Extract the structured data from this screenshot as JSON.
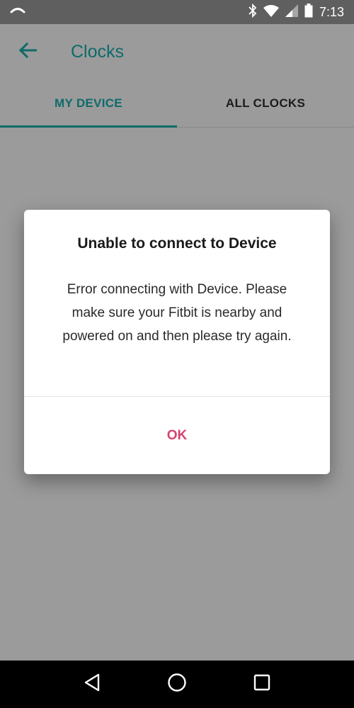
{
  "status_bar": {
    "time": "7:13",
    "icons": [
      "hotspot-icon",
      "bluetooth-icon",
      "wifi-icon",
      "signal-icon",
      "battery-icon"
    ]
  },
  "app_bar": {
    "title": "Clocks",
    "back_icon": "back-arrow-icon"
  },
  "tabs": [
    {
      "label": "MY DEVICE",
      "active": true
    },
    {
      "label": "ALL CLOCKS",
      "active": false
    }
  ],
  "dialog": {
    "title": "Unable to connect to Device",
    "message": "Error connecting with Device. Please make sure your Fitbit is nearby and powered on and then please try again.",
    "ok_label": "OK"
  },
  "nav_bar": {
    "icons": [
      "back-triangle-icon",
      "home-circle-icon",
      "recents-square-icon"
    ]
  },
  "colors": {
    "accent": "#0f6b6b",
    "dialog_button": "#d6436f",
    "scrim_background": "#9b9b9b"
  }
}
